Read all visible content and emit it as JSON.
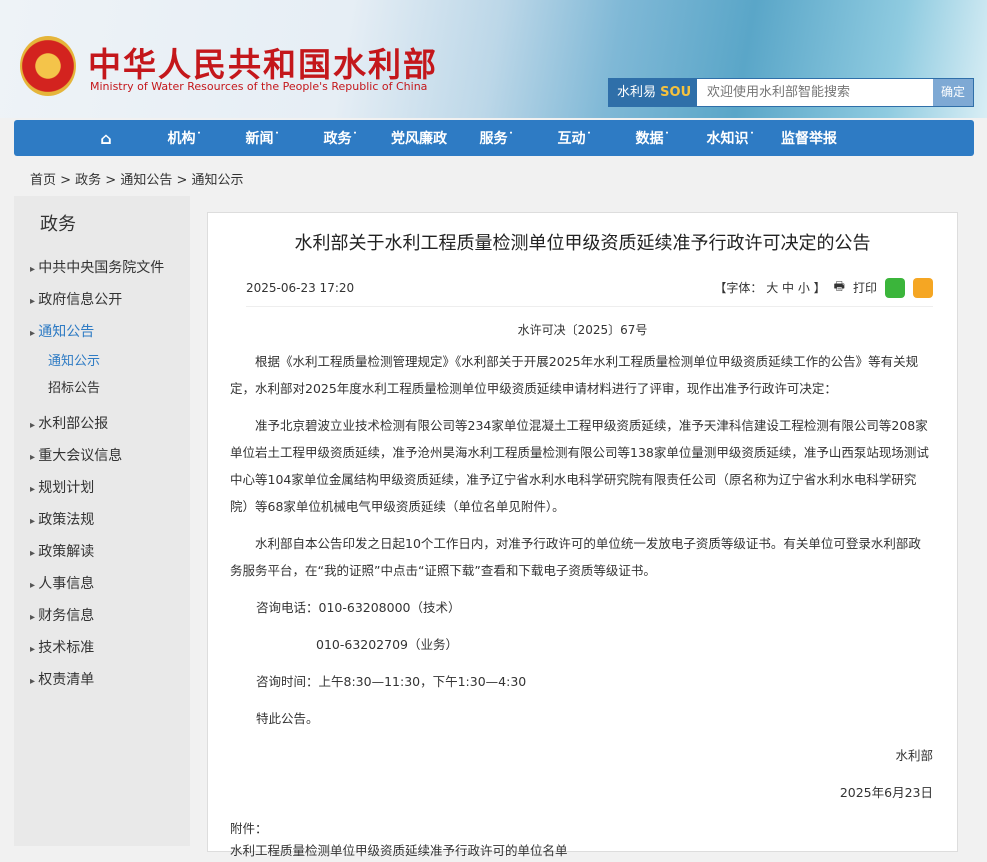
{
  "header": {
    "title_cn": "中华人民共和国水利部",
    "title_en": "Ministry of Water Resources of the People's Republic of China"
  },
  "search": {
    "brand": "水利易",
    "brand_mark": "SOU",
    "placeholder": "欢迎使用水利部智能搜索",
    "submit": "确定"
  },
  "nav": {
    "home": "⌂",
    "items": [
      "机构˙",
      "新闻˙",
      "政务˙",
      "党风廉政",
      "服务˙",
      "互动˙",
      "数据˙",
      "水知识˙",
      "监督举报"
    ]
  },
  "breadcrumb": "首页 > 政务 > 通知公告 > 通知公示",
  "sidebar": {
    "title": "政务",
    "items": [
      "中共中央国务院文件",
      "政府信息公开",
      "通知公告",
      "水利部公报",
      "重大会议信息",
      "规划计划",
      "政策法规",
      "政策解读",
      "人事信息",
      "财务信息",
      "技术标准",
      "权责清单"
    ],
    "subitems": [
      "通知公示",
      "招标公告"
    ]
  },
  "article": {
    "title": "水利部关于水利工程质量检测单位甲级资质延续准予行政许可决定的公告",
    "date": "2025-06-23 17:20",
    "font_label": "【字体： 大 中 小 】",
    "print": "打印",
    "doc_no": "水许可决〔2025〕67号",
    "paragraphs": [
      "根据《水利工程质量检测管理规定》《水利部关于开展2025年水利工程质量检测单位甲级资质延续工作的公告》等有关规定，水利部对2025年度水利工程质量检测单位甲级资质延续申请材料进行了评审，现作出准予行政许可决定：",
      "准予北京碧波立业技术检测有限公司等234家单位混凝土工程甲级资质延续，准予天津科信建设工程检测有限公司等208家单位岩土工程甲级资质延续，准予沧州昊海水利工程质量检测有限公司等138家单位量测甲级资质延续，准予山西泵站现场测试中心等104家单位金属结构甲级资质延续，准予辽宁省水利水电科学研究院有限责任公司（原名称为辽宁省水利水电科学研究院）等68家单位机械电气甲级资质延续（单位名单见附件）。",
      "水利部自本公告印发之日起10个工作日内，对准予行政许可的单位统一发放电子资质等级证书。有关单位可登录水利部政务服务平台，在“我的证照”中点击“证照下载”查看和下载电子资质等级证书。"
    ],
    "phone1": "咨询电话：010-63208000（技术）",
    "phone2": "010-63202709（业务）",
    "hours": "咨询时间：上午8:30—11:30，下午1:30—4:30",
    "closing": "特此公告。",
    "signer": "水利部",
    "sign_date": "2025年6月23日",
    "attachment_label": "附件：",
    "attachment": "水利工程质量检测单位甲级资质延续准予行政许可的单位名单"
  }
}
